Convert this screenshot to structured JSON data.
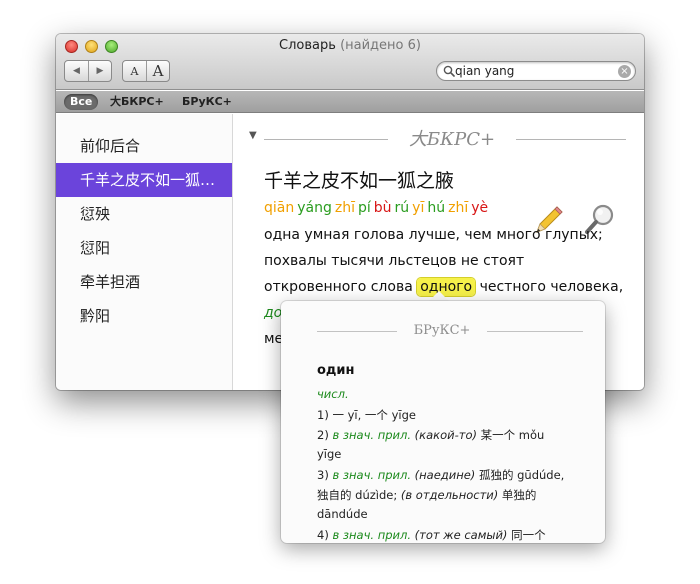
{
  "window": {
    "title": "Словарь",
    "title_sub": "(найдено 6)"
  },
  "toolbar": {
    "back_icon": "◀",
    "forward_icon": "▶",
    "font_small": "A",
    "font_large": "A"
  },
  "search": {
    "value": "qian yang",
    "clear_icon": "×"
  },
  "scope_bar": {
    "items": [
      "Все",
      "大БКРС+",
      "БРуКС+"
    ],
    "selected": "Все"
  },
  "sidebar": {
    "items": [
      "前仰后合",
      "千羊之皮不如一狐…",
      "愆殃",
      "愆阳",
      "牵羊担酒",
      "黔阳"
    ],
    "selected_index": 1
  },
  "entry": {
    "dictionary": "大БКРС+",
    "headword": "千羊之皮不如一狐之腋",
    "pinyin": [
      "qiān",
      "yáng",
      "zhī",
      "pí",
      "bù",
      "rú",
      "yī",
      "hú",
      "zhī",
      "yè"
    ],
    "definition_line1": "одна умная голова лучше, чем много глупых;",
    "definition_line2": "похвалы тысячи льстецов не стоят",
    "definition_line3_before": "откровенного слова",
    "definition_highlight": "одного",
    "definition_line3_after": "честного человека,",
    "definition_line4_start": "до",
    "definition_line5_start": "ме"
  },
  "popover": {
    "dictionary": "БРуКС+",
    "word": "один",
    "pos": "числ.",
    "lines": [
      {
        "num": "1)",
        "text": "一 yī, 一个 yīge"
      },
      {
        "num": "2)",
        "label": "в знач. прил.",
        "paren": "(какой-то)",
        "text": "某一个 mǒu"
      },
      {
        "text": "yīge"
      },
      {
        "num": "3)",
        "label": "в знач. прил.",
        "paren": "(наедине)",
        "text": "孤独的 gūdúde,"
      },
      {
        "text": "独自的 dúzìde;",
        "paren": "(в отдельности)",
        "text2": "单独的"
      },
      {
        "text": "dāndúde"
      },
      {
        "num": "4)",
        "label": "в знач. прил.",
        "paren": "(тот же самый)",
        "text": "同一个"
      }
    ]
  },
  "colors": {
    "selection": "#6b44db",
    "highlight": "#f6f14a",
    "tone_orange": "#f1a000",
    "tone_green": "#2a9d1f",
    "tone_red": "#d81616",
    "example_green": "#1c8a1c"
  }
}
